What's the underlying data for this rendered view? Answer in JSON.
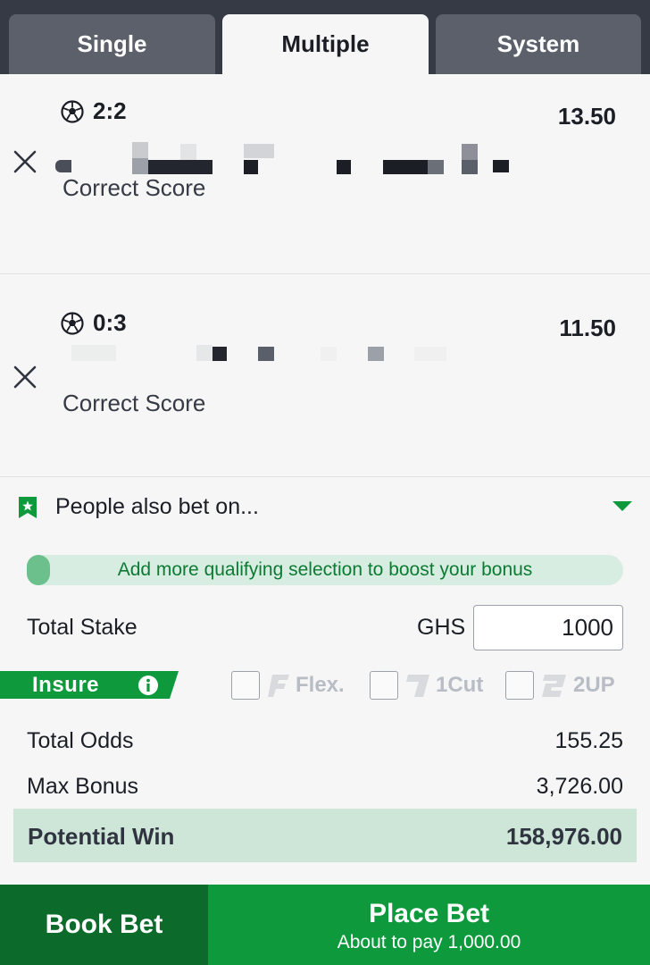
{
  "tabs": [
    {
      "label": "Single",
      "active": false
    },
    {
      "label": "Multiple",
      "active": true
    },
    {
      "label": "System",
      "active": false
    }
  ],
  "selections": [
    {
      "score": "2:2",
      "odds": "13.50",
      "market": "Correct Score",
      "sport_icon": "soccer-ball-icon"
    },
    {
      "score": "0:3",
      "odds": "11.50",
      "market": "Correct Score",
      "sport_icon": "soccer-ball-icon"
    }
  ],
  "also_bet": {
    "label": "People also bet on..."
  },
  "bonus": {
    "message": "Add more qualifying selection to boost your bonus"
  },
  "stake": {
    "label": "Total Stake",
    "currency": "GHS",
    "value": "1000"
  },
  "insure": {
    "label": "Insure",
    "options": [
      {
        "name": "Flex.",
        "logo": "F",
        "checked": false
      },
      {
        "name": "1Cut",
        "logo": "1",
        "checked": false
      },
      {
        "name": "2UP",
        "logo": "2",
        "checked": false
      }
    ]
  },
  "totals": {
    "odds_label": "Total Odds",
    "odds_value": "155.25",
    "bonus_label": "Max Bonus",
    "bonus_value": "3,726.00",
    "win_label": "Potential Win",
    "win_value": "158,976.00"
  },
  "actions": {
    "book_label": "Book Bet",
    "place_label": "Place Bet",
    "place_sub": "About to pay 1,000.00"
  },
  "colors": {
    "brand_green": "#0e9a3c",
    "dark_green": "#0c6b2a",
    "header_dark": "#353a45"
  }
}
